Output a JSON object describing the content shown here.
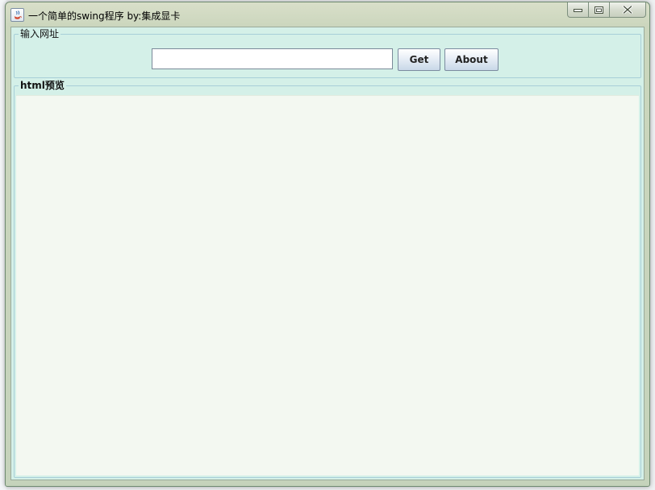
{
  "window": {
    "title": "一个简单的swing程序  by:集成显卡"
  },
  "url_group": {
    "legend": "输入网址",
    "input_value": "",
    "input_placeholder": "",
    "get_label": "Get",
    "about_label": "About"
  },
  "preview_group": {
    "legend": "html预览"
  },
  "icons": {
    "app": "java-cup-icon",
    "minimize": "minimize-icon",
    "maximize": "maximize-icon",
    "close": "close-icon"
  },
  "colors": {
    "client_bg": "#d4f0e8",
    "preview_bg": "#f3f8f1",
    "group_border": "#a8cfd8"
  }
}
